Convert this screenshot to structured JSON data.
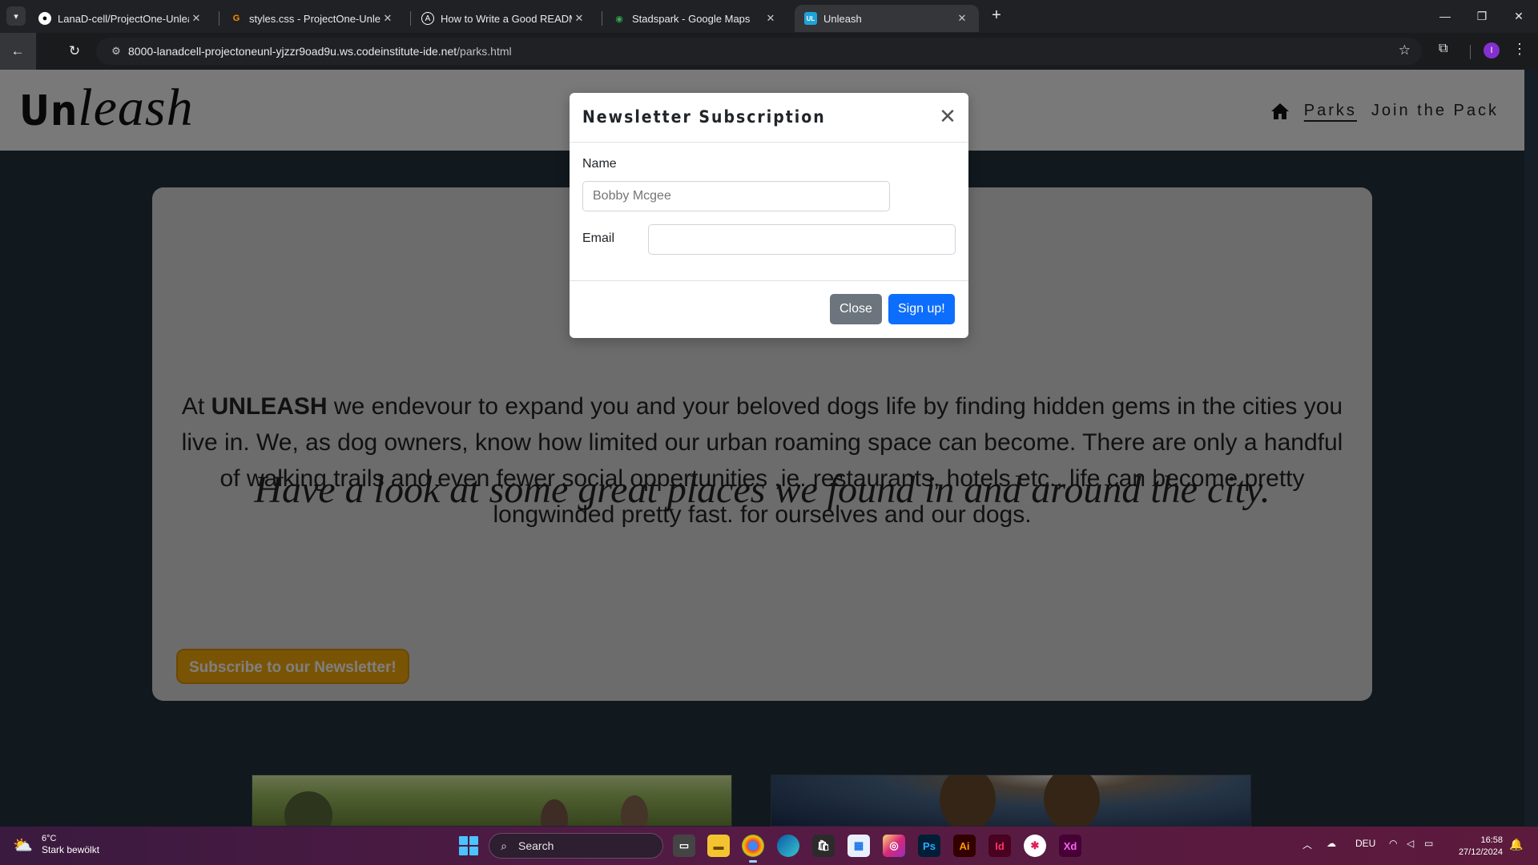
{
  "browser": {
    "tabs": [
      {
        "label": "LanaD-cell/ProjectOne-Unleash",
        "icon": "github-icon"
      },
      {
        "label": "styles.css - ProjectOne-Unleash",
        "icon": "gitpod-icon"
      },
      {
        "label": "How to Write a Good README",
        "icon": "article-icon"
      },
      {
        "label": "Stadspark - Google Maps",
        "icon": "maps-pin-icon"
      },
      {
        "label": "Unleash",
        "icon": "unleash-favicon"
      }
    ],
    "url_host": "8000-lanadcell-projectoneunl-yjzzr9oad9u.ws.codeinstitute-ide.net",
    "url_path": "/parks.html",
    "profile_initial": "I"
  },
  "site": {
    "logo_prefix": "Un",
    "logo_suffix": "leash",
    "nav": [
      {
        "label": "Parks",
        "active": true
      },
      {
        "label": "Join the Pack",
        "active": false
      }
    ]
  },
  "hero": {
    "intro_prefix": "At ",
    "brand": "UNLEASH",
    "intro_rest": " we endevour to expand you and your beloved dogs life by finding hidden gems in the cities you live in. We, as dog owners, know how limited our urban roaming space can become. There are only a handful of walking trails and even fewer social oppertunities ,ie. restaurants, hotels etc., life can become pretty longwinded pretty fast. for ourselves and our dogs.",
    "tagline": "Have a look at some great places we found in and around the city.",
    "subscribe_label": "Subscribe to our Newsletter!"
  },
  "modal": {
    "title": "Newsletter Subscription",
    "name_label": "Name",
    "name_placeholder": "Bobby Mcgee",
    "email_label": "Email",
    "email_value": "",
    "close_label": "Close",
    "signup_label": "Sign up!"
  },
  "taskbar": {
    "temperature": "6°C",
    "weather": "Stark bewölkt",
    "search_placeholder": "Search",
    "language": "DEU",
    "time": "16:58",
    "date": "27/12/2024",
    "apps": [
      "task-view",
      "file-explorer",
      "chrome",
      "edge",
      "store",
      "calendar",
      "instagram",
      "Ps",
      "Ai",
      "Id",
      "slack",
      "Xd"
    ]
  },
  "colors": {
    "accent_blue": "#0d6efd",
    "secondary_gray": "#6c757d",
    "subscribe_orange": "#f5a90a",
    "page_bg": "#22323f"
  }
}
